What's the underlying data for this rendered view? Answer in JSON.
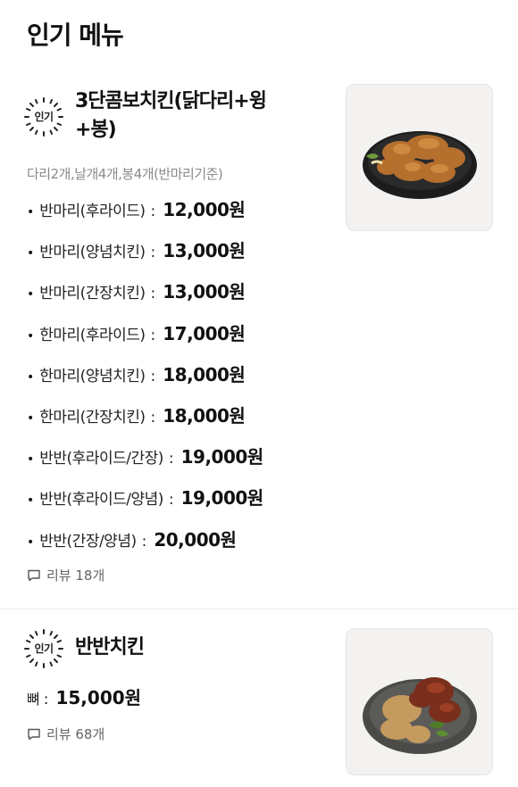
{
  "page": {
    "title": "인기 메뉴"
  },
  "colors": {
    "text": "#111111",
    "muted": "#8a8a8a",
    "divider": "#ececec"
  },
  "menu": [
    {
      "badge": "인기",
      "name": "3단콤보치킨(닭다리+윙+봉)",
      "name_line1": "3단콤보치킨(닭다리+윙",
      "name_line2": "+봉)",
      "description": "다리2개,날개4개,봉4개(반마리기준)",
      "image_icon": "fried-chicken-plate",
      "options": [
        {
          "label": "반마리(후라이드)",
          "price": "12,000원"
        },
        {
          "label": "반마리(양념치킨)",
          "price": "13,000원"
        },
        {
          "label": "반마리(간장치킨)",
          "price": "13,000원"
        },
        {
          "label": "한마리(후라이드)",
          "price": "17,000원"
        },
        {
          "label": "한마리(양념치킨)",
          "price": "18,000원"
        },
        {
          "label": "한마리(간장치킨)",
          "price": "18,000원"
        },
        {
          "label": "반반(후라이드/간장)",
          "price": "19,000원"
        },
        {
          "label": "반반(후라이드/양념)",
          "price": "19,000원"
        },
        {
          "label": "반반(간장/양념)",
          "price": "20,000원"
        }
      ],
      "review": "리뷰 18개"
    },
    {
      "badge": "인기",
      "name": "반반치킨",
      "image_icon": "half-half-chicken-plate",
      "options": [
        {
          "label": "뼈",
          "price": "15,000원"
        }
      ],
      "review": "리뷰 68개"
    }
  ]
}
